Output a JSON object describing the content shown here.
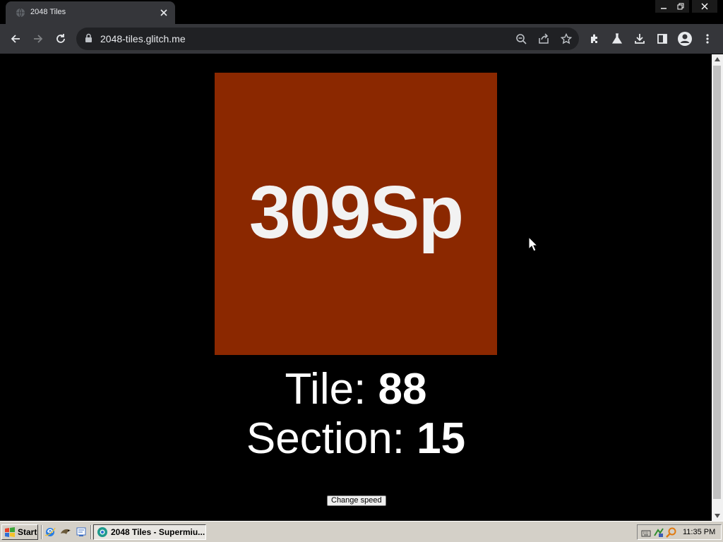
{
  "browser": {
    "tab_title": "2048 Tiles",
    "url": "2048-tiles.glitch.me"
  },
  "page": {
    "tile": {
      "label": "309Sp",
      "color": "#8b2800"
    },
    "tile_prefix": "Tile: ",
    "tile_number": "88",
    "section_prefix": "Section: ",
    "section_number": "15",
    "change_speed_label": "Change speed"
  },
  "taskbar": {
    "start_label": "Start",
    "task_label": "2048 Tiles - Supermiu...",
    "clock": "11:35 PM"
  },
  "icons": {
    "tab": [
      "globe-icon",
      "close-icon"
    ],
    "window": [
      "minimize-icon",
      "restore-icon",
      "close-icon"
    ],
    "toolbar": [
      "back-arrow-icon",
      "forward-arrow-icon",
      "reload-icon",
      "lock-icon",
      "zoom-icon",
      "share-icon",
      "star-icon",
      "extensions-icon",
      "labs-icon",
      "download-icon",
      "side-panel-icon",
      "profile-icon",
      "menu-icon"
    ],
    "quick_launch": [
      "internet-explorer-icon",
      "outlook-icon",
      "desktop-icon"
    ],
    "tray": [
      "keyboard-icon",
      "network-icon",
      "search-icon"
    ]
  }
}
